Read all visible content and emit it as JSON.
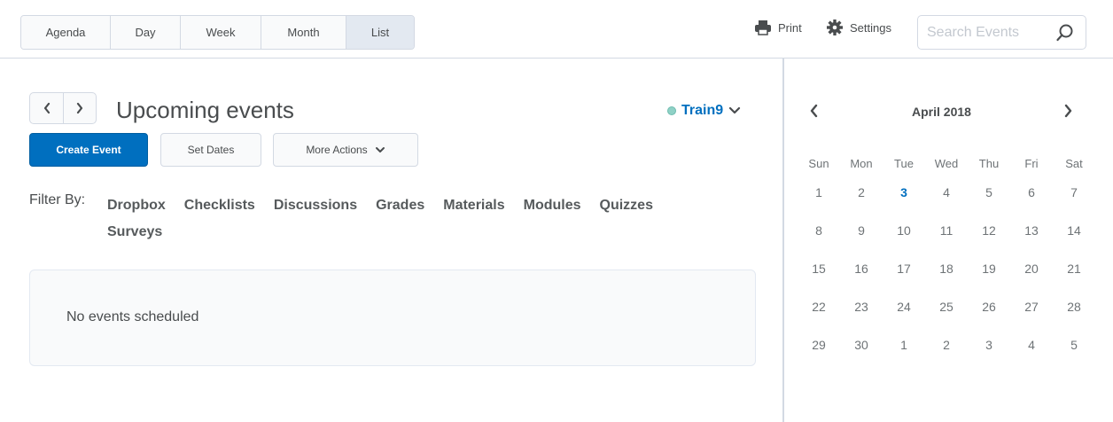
{
  "view_tabs": [
    {
      "label": "Agenda",
      "active": false
    },
    {
      "label": "Day",
      "active": false
    },
    {
      "label": "Week",
      "active": false
    },
    {
      "label": "Month",
      "active": false
    },
    {
      "label": "List",
      "active": true
    }
  ],
  "toolbar": {
    "print_label": "Print",
    "settings_label": "Settings",
    "search_placeholder": "Search Events"
  },
  "main": {
    "title": "Upcoming events",
    "org_name": "Train9",
    "create_label": "Create Event",
    "set_dates_label": "Set Dates",
    "more_actions_label": "More Actions",
    "filter_label": "Filter By:",
    "filters": [
      "Dropbox",
      "Checklists",
      "Discussions",
      "Grades",
      "Materials",
      "Modules",
      "Quizzes",
      "Surveys"
    ],
    "empty_message": "No events scheduled"
  },
  "calendar": {
    "month_label": "April 2018",
    "weekdays": [
      "Sun",
      "Mon",
      "Tue",
      "Wed",
      "Thu",
      "Fri",
      "Sat"
    ],
    "weeks": [
      [
        "1",
        "2",
        "3",
        "4",
        "5",
        "6",
        "7"
      ],
      [
        "8",
        "9",
        "10",
        "11",
        "12",
        "13",
        "14"
      ],
      [
        "15",
        "16",
        "17",
        "18",
        "19",
        "20",
        "21"
      ],
      [
        "22",
        "23",
        "24",
        "25",
        "26",
        "27",
        "28"
      ],
      [
        "29",
        "30",
        "1",
        "2",
        "3",
        "4",
        "5"
      ]
    ],
    "today": "3"
  },
  "colors": {
    "accent": "#006fbf",
    "border": "#d3d9e3",
    "status_dot": "#8fd1c6"
  }
}
